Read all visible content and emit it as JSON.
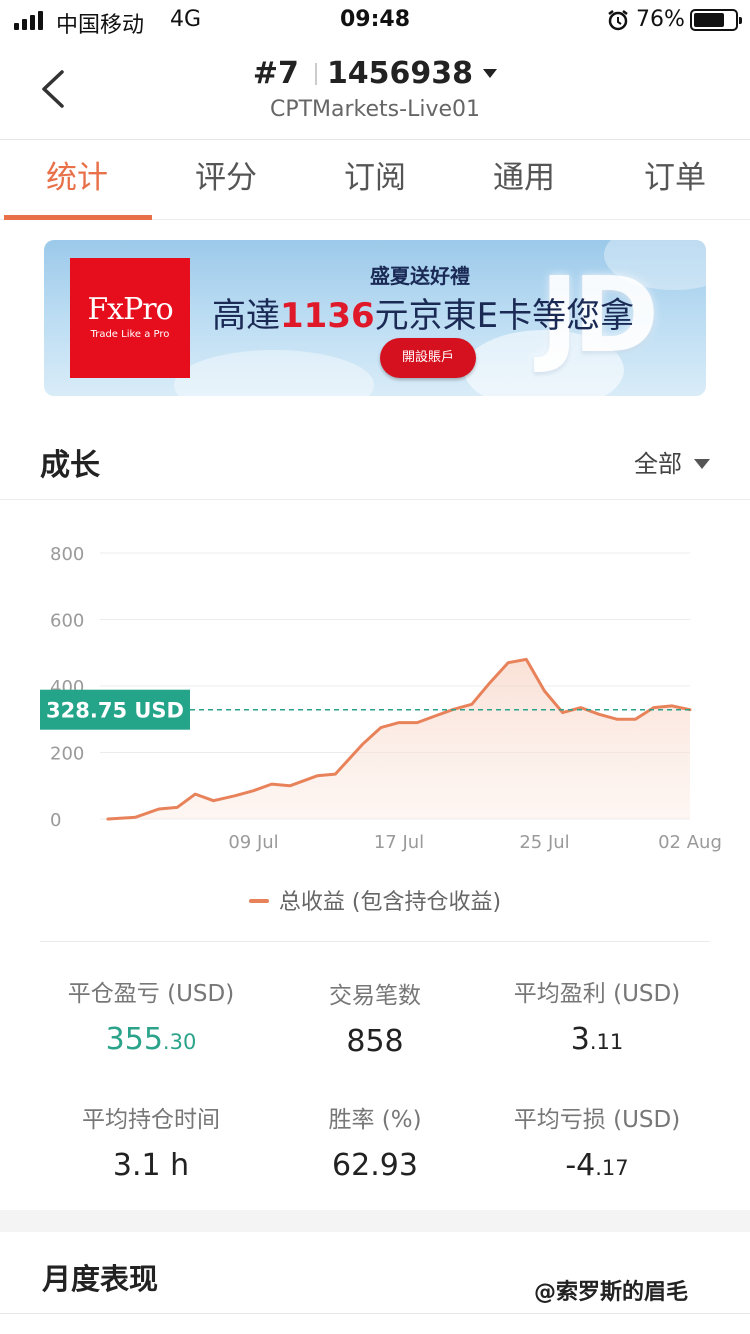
{
  "status_bar": {
    "carrier": "中国移动",
    "network": "4G",
    "time": "09:48",
    "battery": "76%",
    "battery_level": 0.76
  },
  "header": {
    "rank": "#7",
    "account_number": "1456938",
    "server": "CPTMarkets-Live01"
  },
  "tabs": [
    {
      "label": "统计",
      "active": true
    },
    {
      "label": "评分",
      "active": false
    },
    {
      "label": "订阅",
      "active": false
    },
    {
      "label": "通用",
      "active": false
    },
    {
      "label": "订单",
      "active": false
    }
  ],
  "banner": {
    "brand": "FxPro",
    "tagline": "Trade Like a Pro",
    "title": "盛夏送好禮",
    "headline_pre": "高達",
    "headline_amount": "1136",
    "headline_post": "元京東E卡等您拿",
    "cta": "開設賬戶",
    "decor": "JD"
  },
  "growth": {
    "title": "成长",
    "range": "全部"
  },
  "chart_data": {
    "type": "area",
    "current_value_label": "328.75 USD",
    "current_value": 328.75,
    "ylim": [
      0,
      800
    ],
    "yticks": [
      0,
      200,
      400,
      600,
      800
    ],
    "xticks": [
      {
        "label": "09 Jul",
        "day": 9
      },
      {
        "label": "17 Jul",
        "day": 17
      },
      {
        "label": "25 Jul",
        "day": 25
      },
      {
        "label": "02 Aug",
        "day": 33
      }
    ],
    "xlim": [
      1,
      33
    ],
    "series": [
      {
        "name": "总收益 (包含持仓收益)",
        "color": "#e8825a",
        "x": [
          1,
          2.5,
          3.8,
          4.8,
          5.8,
          6.8,
          8,
          9,
          10,
          11,
          12.5,
          13.5,
          15,
          16,
          17,
          18,
          19,
          20,
          21,
          22,
          23,
          24,
          25,
          26,
          27,
          28,
          29,
          30,
          31,
          32,
          33
        ],
        "y": [
          0,
          5,
          30,
          35,
          75,
          55,
          70,
          85,
          105,
          100,
          130,
          135,
          225,
          275,
          290,
          290,
          310,
          330,
          345,
          410,
          470,
          480,
          385,
          320,
          335,
          315,
          300,
          300,
          335,
          340,
          328.75
        ]
      }
    ]
  },
  "stats": [
    {
      "label": "平仓盈亏 (USD)",
      "int": "355",
      "dec": ".30",
      "color": "#2aa38a"
    },
    {
      "label": "交易笔数",
      "int": "858",
      "dec": ""
    },
    {
      "label": "平均盈利 (USD)",
      "int": "3",
      "dec": ".11"
    },
    {
      "label": "平均持仓时间",
      "int": "3.1 h",
      "dec": ""
    },
    {
      "label": "胜率 (%)",
      "int": "62.93",
      "dec": ""
    },
    {
      "label": "平均亏损 (USD)",
      "int": "-4",
      "dec": ".17"
    }
  ],
  "monthly": {
    "title": "月度表现"
  },
  "watermark": "@索罗斯的眉毛"
}
